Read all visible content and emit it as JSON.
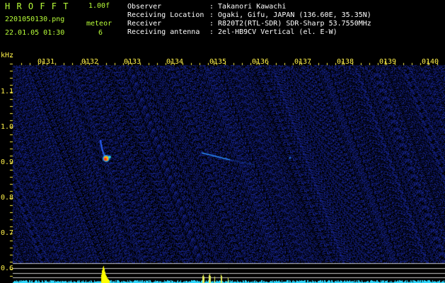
{
  "app": {
    "logo": "H R O F F T",
    "version": "1.00f",
    "filename": "2201050130.png",
    "datetime": "22.01.05 01:30",
    "meteor_label": "meteor",
    "meteor_count": "6"
  },
  "meta": {
    "observer_label": "Observer",
    "observer_value": ": Takanori Kawachi",
    "location_label": "Receiving Location",
    "location_value": ": Ogaki, Gifu, JAPAN (136.60E, 35.35N)",
    "receiver_label": "Receiver",
    "receiver_value": ": R820T2(RTL-SDR) SDR-Sharp 53.7550MHz",
    "antenna_label": "Receiving antenna",
    "antenna_value": ": 2el-HB9CV Vertical (el. E-W)"
  },
  "axes": {
    "y_unit": "kHz",
    "y_ticks": [
      "1.1",
      "1.0",
      "0.9",
      "0.8",
      "0.7",
      "0.6"
    ],
    "x_ticks": [
      "0131",
      "0132",
      "0133",
      "0134",
      "0135",
      "0136",
      "0137",
      "0138",
      "0139",
      "0140"
    ]
  },
  "colors": {
    "background": "#000000",
    "noise": "#0b1a6a",
    "accent_lime": "#b9ff39",
    "tick_yellow": "#fff14a",
    "power_cyan": "#2fd9ff",
    "power_yellow": "#ffff00"
  }
}
